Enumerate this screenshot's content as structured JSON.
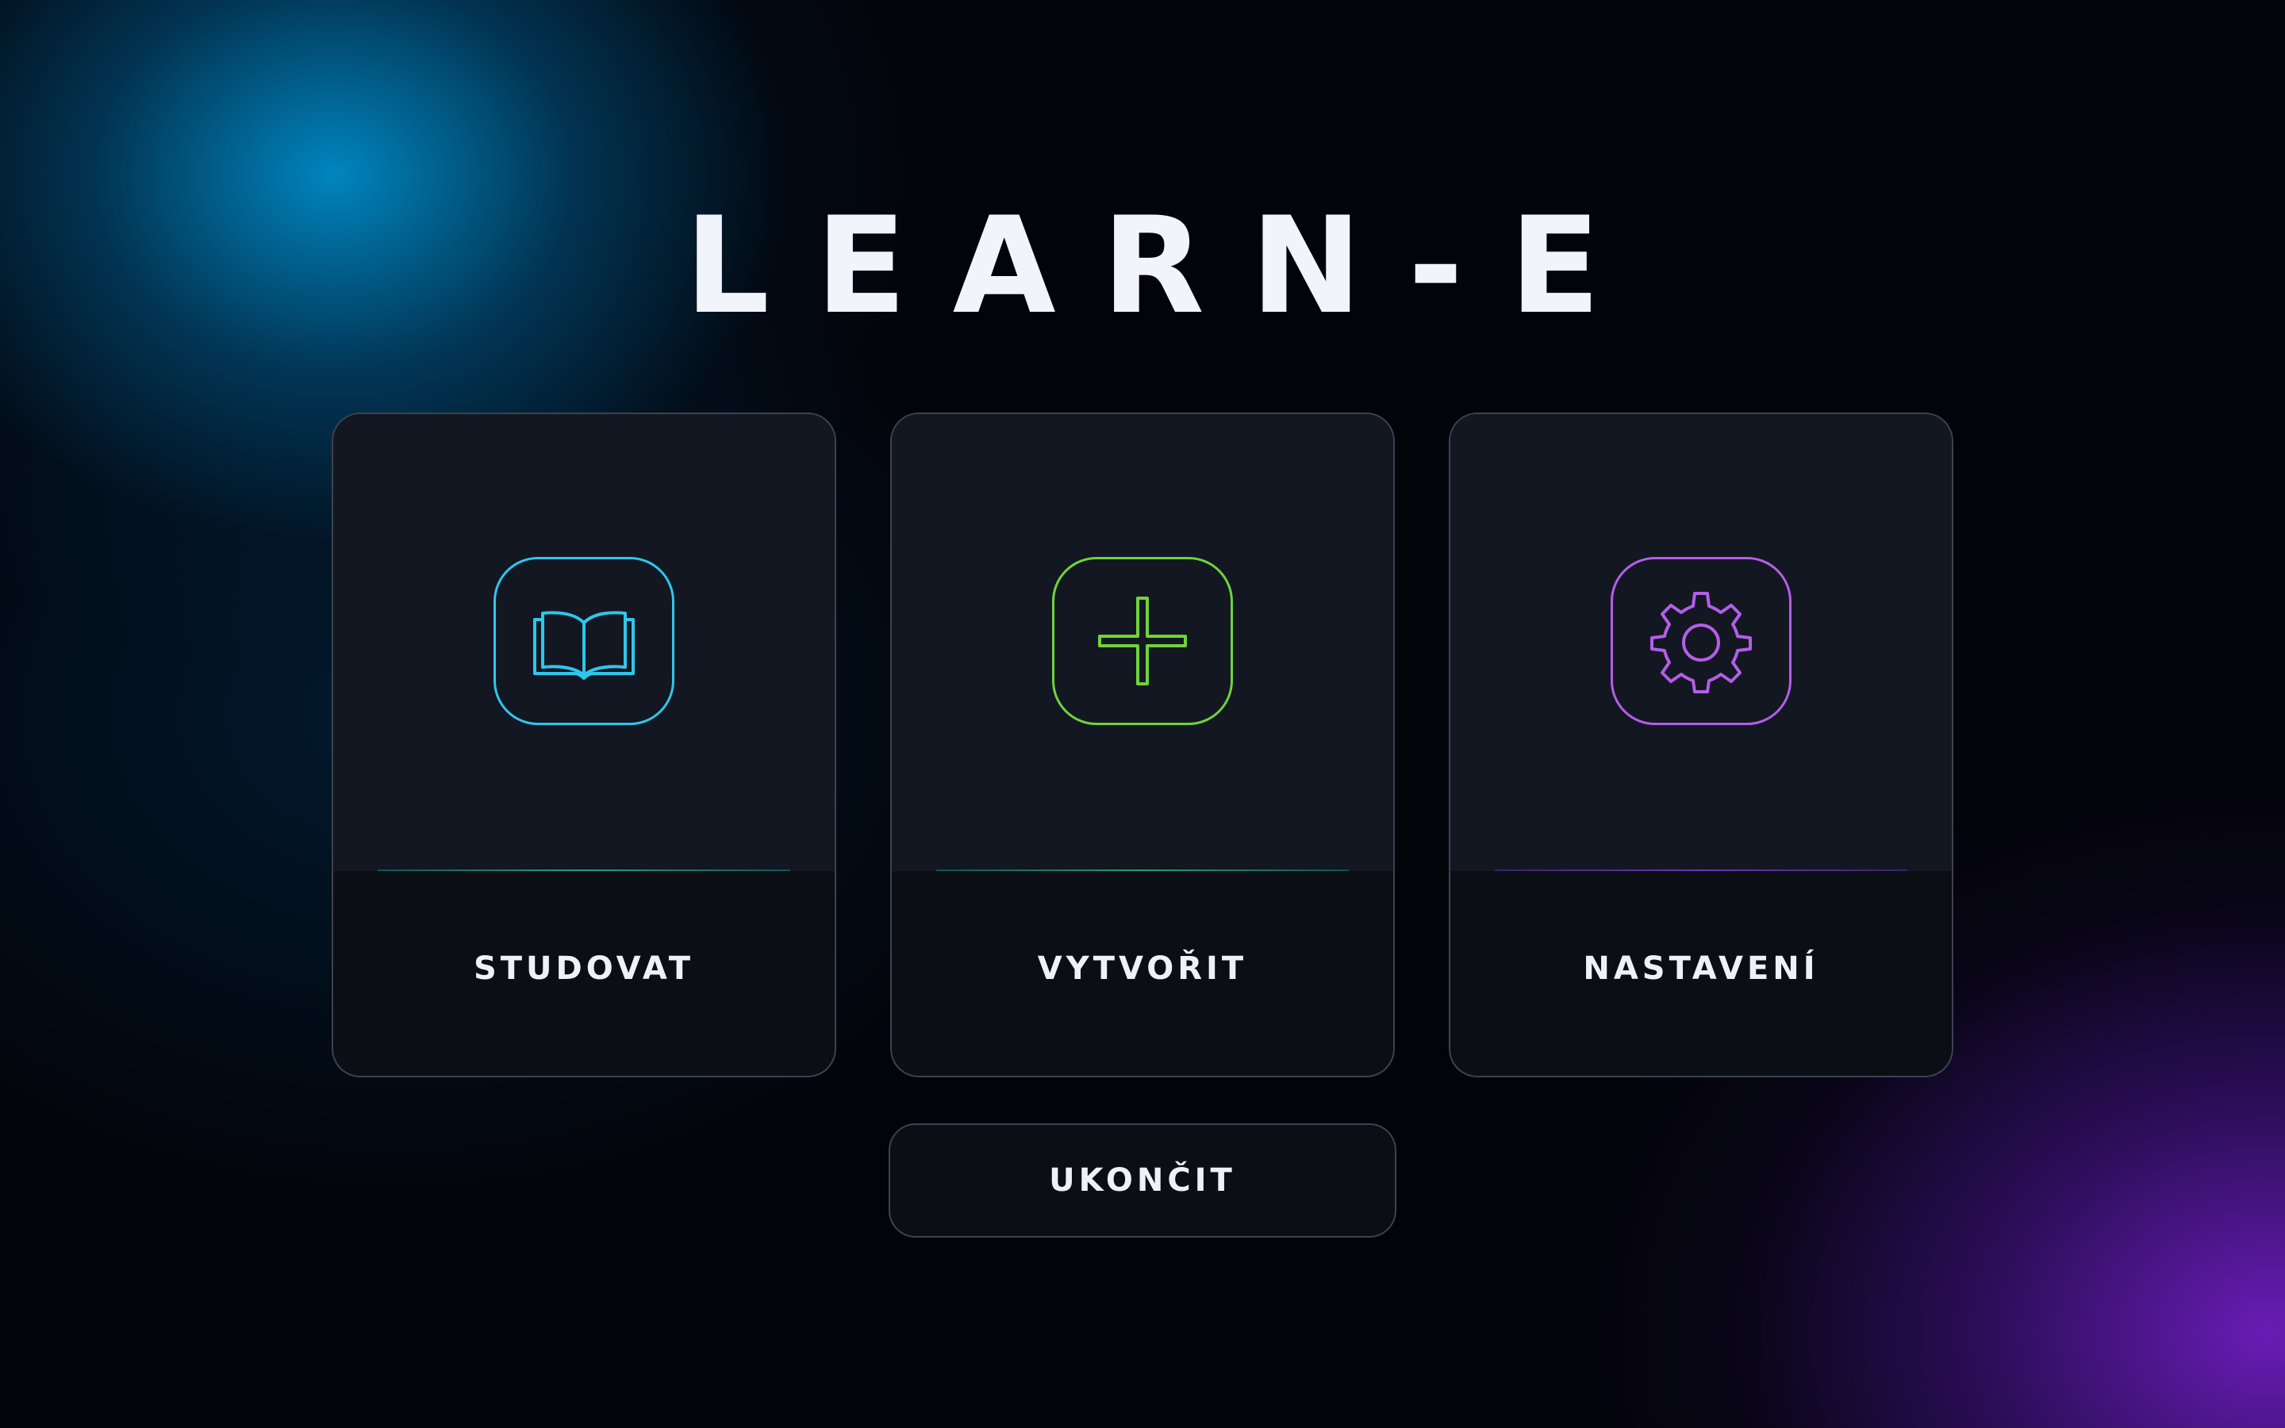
{
  "app": {
    "title": "LEARN-E"
  },
  "menu": {
    "cards": [
      {
        "label": "STUDOVAT",
        "icon": "book-icon",
        "accent": "#2fc6ea"
      },
      {
        "label": "VYTVOŘIT",
        "icon": "plus-icon",
        "accent": "#6fd33a"
      },
      {
        "label": "NASTAVENÍ",
        "icon": "gear-icon",
        "accent": "#b45ee8"
      }
    ],
    "exit_label": "UKONČIT"
  },
  "colors": {
    "background": "#03040a",
    "glow_top_left": "#008cc8",
    "glow_bottom_right": "#6e1ebe",
    "card_top": "#131722",
    "card_bottom": "#0b0e15",
    "text": "#eef1f7"
  }
}
